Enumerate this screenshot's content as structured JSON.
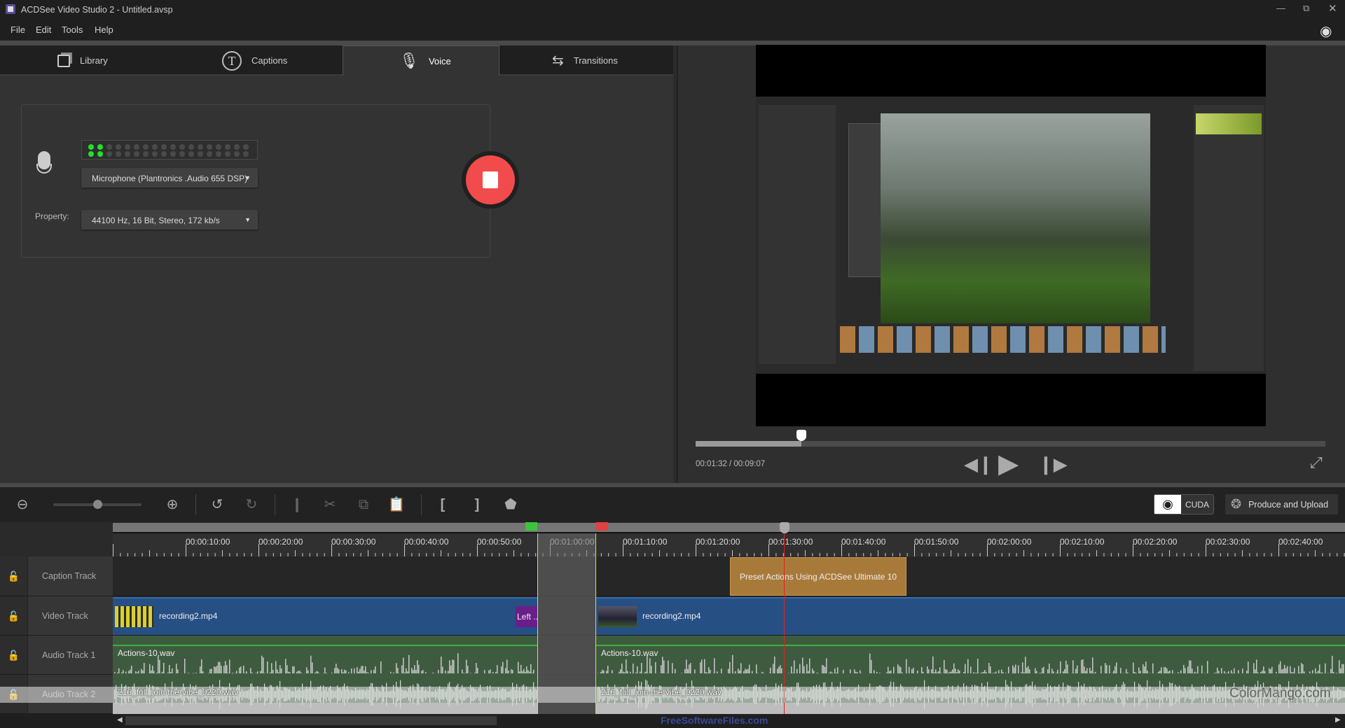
{
  "window": {
    "title": "ACDSee Video Studio 2 - Untitled.avsp",
    "controls": [
      "minimize",
      "restore",
      "close"
    ]
  },
  "menu": [
    "File",
    "Edit",
    "Tools",
    "Help"
  ],
  "tabs": [
    {
      "label": "Library",
      "icon": "library-icon"
    },
    {
      "label": "Captions",
      "icon": "captions-icon"
    },
    {
      "label": "Voice",
      "icon": "microphone-icon",
      "active": true
    },
    {
      "label": "Transitions",
      "icon": "transitions-icon"
    }
  ],
  "voice": {
    "meter_level": 2,
    "meter_segments": 18,
    "device": "Microphone (Plantronics .Audio 655 DSP)",
    "property_label": "Property:",
    "property": "44100 Hz, 16 Bit, Stereo, 172 kb/s",
    "record_state": "recording",
    "colors": {
      "meter_on": "#22e02a",
      "record": "#f24b4b"
    }
  },
  "player": {
    "time": "00:01:32 / 00:09:07",
    "progress": 0.168
  },
  "toolbar": {
    "cuda_label": "CUDA",
    "produce_label": "Produce and Upload",
    "zoom_level": 0.5
  },
  "timeline": {
    "ruler_labels": [
      "00:00:10:00",
      "00:00:20:00",
      "00:00:30:00",
      "00:00:40:00",
      "00:00:50:00",
      "00:01:00:00",
      "00:01:10:00",
      "00:01:20:00",
      "00:01:30:00",
      "00:01:40:00",
      "00:01:50:00",
      "00:02:00:00",
      "00:02:10:00",
      "00:02:20:00",
      "00:02:30:00",
      "00:02:40:00"
    ],
    "tracks": [
      {
        "name": "Caption Track"
      },
      {
        "name": "Video Track"
      },
      {
        "name": "Audio Track 1"
      },
      {
        "name": "Audio Track 2"
      }
    ],
    "caption_clip": "Preset Actions Using ACDSee Ultimate 10",
    "video_clips": [
      "recording2.mp4",
      "recording2.mp4"
    ],
    "transition_label": "Left ...",
    "audio1_clips": [
      "Actions-10.wav",
      "Actions-10.wav"
    ],
    "audio2_clips": [
      "216_full_join-the-vibe_0220.wav",
      "216_full_join-the-vibe_0220.wav"
    ],
    "colors": {
      "video": "#264f84",
      "audio": "#3e5b40",
      "caption": "#a87a3a",
      "transition": "#6a1e8a",
      "playhead": "#e02020",
      "in_marker": "#3cc43c",
      "out_marker": "#e04040"
    }
  },
  "watermarks": {
    "right": "ColorMango.com",
    "bottom": "FreeSoftwareFiles.com"
  }
}
